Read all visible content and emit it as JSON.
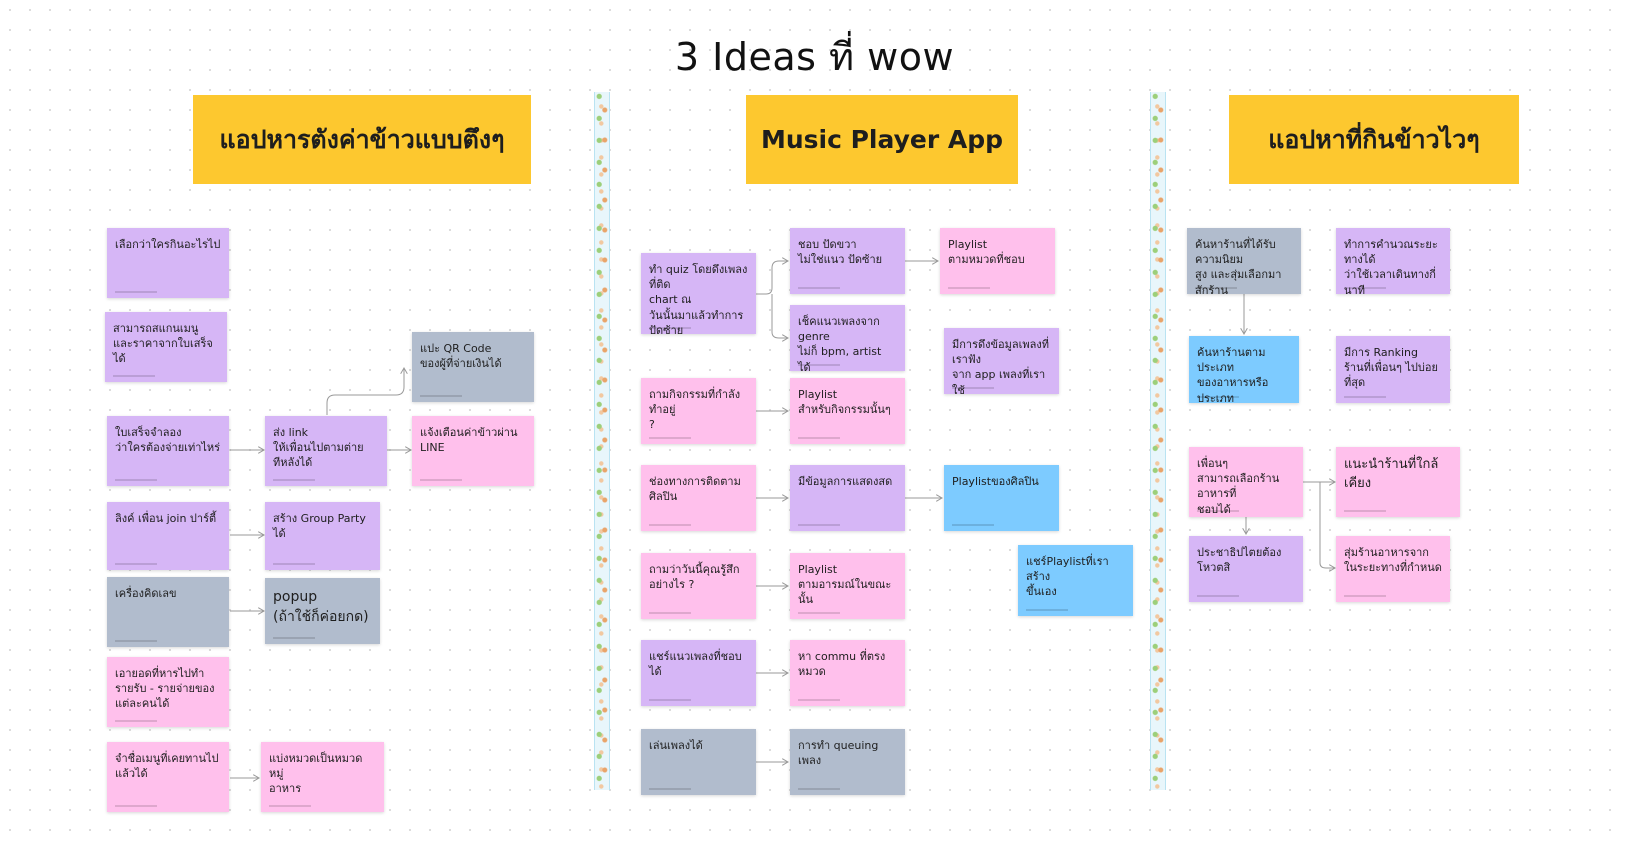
{
  "board": {
    "title": "3 Ideas ที่ wow"
  },
  "columns": [
    {
      "heading": "แอปหารตังค่าข้าวแบบตึงๆ"
    },
    {
      "heading": "Music Player App"
    },
    {
      "heading": "แอปหาที่กินข้าวไวๆ"
    }
  ],
  "notes": {
    "n1": "เลือกว่าใครกินอะไรไป",
    "n2": "สามารถสแกนเมนู\nและราคาจากใบเสร็จได้",
    "n3": "ใบเสร็จจำลอง\nว่าใครต้องจ่ายเท่าไหร่",
    "n4": "ส่ง link\nให้เพื่อนไปตามต่ายทีหลังได้",
    "n5": "แปะ QR Code\nของผู้ที่จ่ายเงินได้",
    "n6": "แจ้งเตือนค่าข้าวผ่าน LINE",
    "n7": "ลิงค์ เพื่อน join ปาร์ตี้",
    "n8": "สร้าง Group Party ได้",
    "n9": "เครื่องคิดเลข",
    "n10": "popup\n(ถ้าใช้ก็ค่อยกด)",
    "n11": "เอายอดที่หารไปทำ\nรายรับ - รายจ่ายของ\nแต่ละคนได้",
    "n12": "จำชื่อเมนูที่เคยทานไปแล้วได้",
    "n13": "แบ่งหมวดเป็นหมวดหมู่\nอาหาร",
    "m1": "ทำ quiz โดยดึงเพลงที่ติด\nchart ณ\nวันนั้นมาแล้วทำการปัดซ้าย\nขวา เลือกเพลงที่ชอบ",
    "m2": "ชอบ ปัดขวา\nไม่ใช่แนว ปัดซ้าย",
    "m3": "Playlist\nตามหมวดที่ชอบ",
    "m4": "เช็คแนวเพลงจาก  genre\nไม่ก็ bpm, artist ได้",
    "m5": "มีการดึงข้อมูลเพลงที่เราฟัง\nจาก app เพลงที่เราใช้",
    "m6": "ถามกิจกรรมที่กำลังทำอยู่\n?",
    "m7": "Playlist\nสำหรับกิจกรรมนั้นๆ",
    "m8": "ช่องทางการติดตาม\nศิลปิน",
    "m9": "มีข้อมูลการแสดงสด",
    "m10": "Playlistของศิลปิน",
    "m11": "แชร์Playlistที่เราสร้าง\nขึ้นเอง",
    "m12": "ถามว่าวันนี้คุณรู้สึก\nอย่างไร ?",
    "m13": "Playlist\nตามอารมณ์ในขณะนั้น",
    "m14": "แชร์แนวเพลงที่ชอบได้",
    "m15": "หา commu ที่ตรงหมวด",
    "m16": "เล่นเพลงได้",
    "m17": "การทำ queuing เพลง",
    "f1": "ค้นหาร้านที่ได้รับความนิยม\nสูง และสุ่มเลือกมาสักร้าน\nในระยะที่กำหนด",
    "f2": "ทำการคำนวณระยะทางได้\nว่าใช้เวลาเดินทางกี่นาที",
    "f3": "ค้นหาร้านตามประเภท\nของอาหารหรือประเภท\nร้านที่เราต้องการ",
    "f4": "มีการ Ranking\nร้านที่เพื่อนๆ ไปบ่อยที่สุด",
    "f5": "เพื่อนๆ\nสามารถเลือกร้านอาหารที่\nชอบได้",
    "f6": "แนะนำร้านที่ใกล้เคียง",
    "f7": "ประชาธิปไตยต้องโหวตสิ",
    "f8": "สุ่มร้านอาหารจาก\nในระยะทางที่กำหนด"
  }
}
